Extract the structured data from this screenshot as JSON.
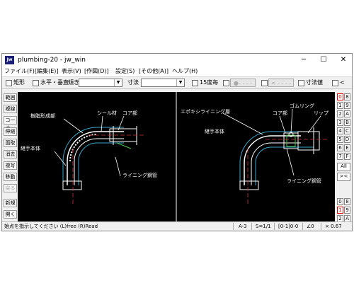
{
  "window": {
    "logo": "Jw",
    "title": "plumbing-20 - jw_win",
    "controls": {
      "minimize": "─",
      "maximize": "☐",
      "close": "✕"
    }
  },
  "menubar": [
    "ファイル(F)",
    "[編集(E)]",
    "表示(V)",
    "[作図(D)]",
    "設定(S)",
    "[その他(A)]",
    "ヘルプ(H)"
  ],
  "toolbar": {
    "rect_label": "矩形",
    "horiz_label": "水平・垂直",
    "slope_label": "傾き",
    "dim_label": "寸法",
    "deg15_label": "15度毎",
    "circle_btn": "●- - - -",
    "arrow_btn": "< - - - -",
    "dimval_label": "寸法値",
    "less_label": "<"
  },
  "left_tools": [
    "範囲",
    "複線",
    "コーナー",
    "伸縮",
    "面取",
    "消去",
    "複写",
    "移動",
    "戻る",
    "新規",
    "開く",
    "上書"
  ],
  "right_tools": {
    "pairs": [
      [
        "0",
        "8"
      ],
      [
        "1",
        "9"
      ],
      [
        "2",
        "A"
      ],
      [
        "3",
        "B"
      ],
      [
        "4",
        "C"
      ],
      [
        "5",
        "D"
      ],
      [
        "6",
        "E"
      ],
      [
        "7",
        "F"
      ]
    ],
    "all": "All",
    "x": "><",
    "layer_pairs": [
      [
        "0",
        "8"
      ],
      [
        "1",
        "9"
      ],
      [
        "2",
        "A"
      ]
    ]
  },
  "drawing": {
    "left": {
      "seal": "シール材",
      "core": "コア部",
      "resin": "樹脂形成部",
      "body": "継手本体",
      "lining": "ライニング鋼管"
    },
    "right": {
      "epoxy": "エポキシライニング層",
      "rubber": "ゴムリング",
      "core": "コア部",
      "rip": "リップ",
      "body": "継手本体",
      "lining": "ライニング鋼管"
    }
  },
  "status": {
    "message": "始点を指示してください (L)free (R)Read",
    "paper": "A-3",
    "scale": "S=1/1",
    "layer": "[0-1]0-0",
    "angle": "∠0",
    "zoom": "× 0.67"
  },
  "colors": {
    "canvas_bg": "#000000",
    "white_line": "#ffffff",
    "cyan_line": "#3aa6c8",
    "green_line": "#49c34a",
    "selected_layer": "#dd0000"
  }
}
